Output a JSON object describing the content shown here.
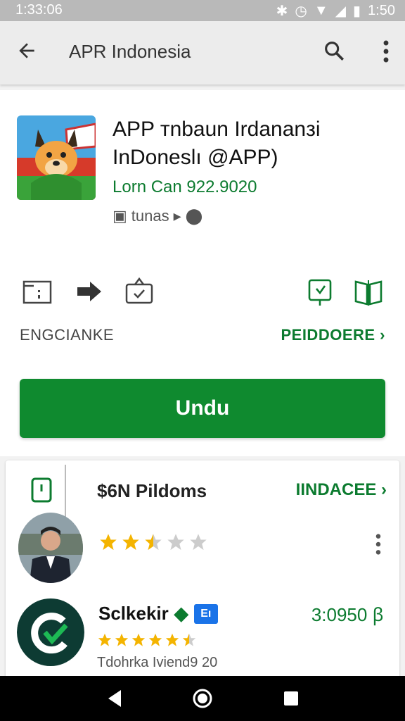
{
  "status_bar": {
    "time": "1:33:06",
    "clock": "1:50"
  },
  "app_bar": {
    "title": "APR Indonesia"
  },
  "app": {
    "name_line1": "APP тnbaun Irdananзi",
    "name_line2": "InDoneslı @APP)",
    "developer": "Lorn Can 922.9020",
    "meta_label": "tunas"
  },
  "labels": {
    "left": "ENGCIANKE",
    "right": "PEIDDOERE ›"
  },
  "install": {
    "label": "Undu"
  },
  "reviews": {
    "title": "$6N Pildoms",
    "link": "IINDACEE ›",
    "first": {
      "stars": 2.5
    },
    "second": {
      "name": "Sclkekir",
      "badge": "Eı",
      "count": "3:0950",
      "count_suffix": "ꞵ",
      "stars": 4.5,
      "date": "Tdohrka Iviend9 20"
    }
  },
  "colors": {
    "accent": "#0f8a2f",
    "link": "#0c7b2f",
    "star": "#f4b400"
  }
}
